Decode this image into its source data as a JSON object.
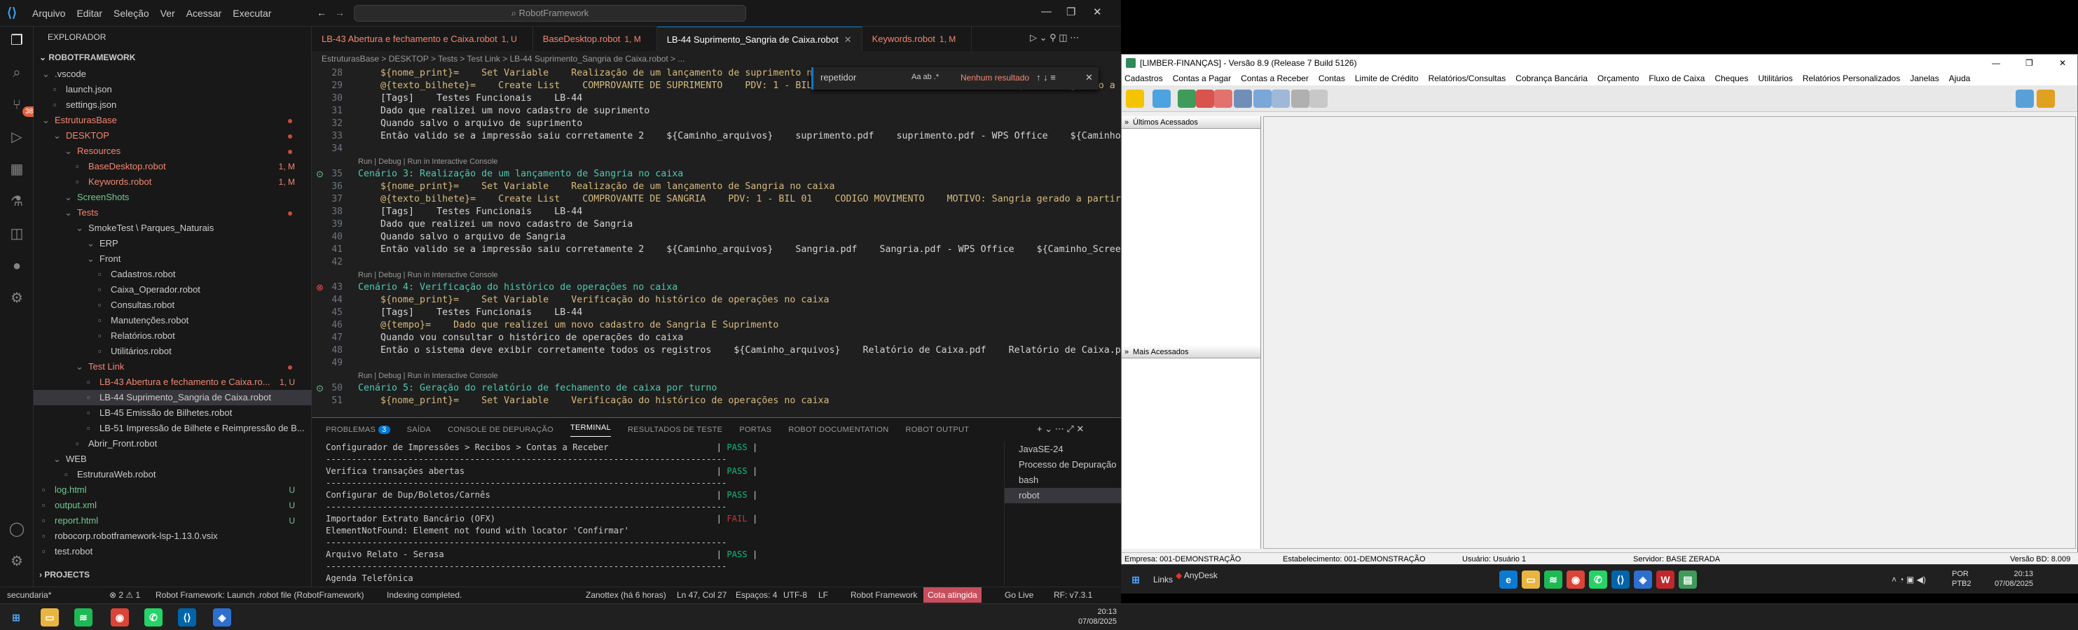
{
  "vscode": {
    "menu": [
      "Arquivo",
      "Editar",
      "Seleção",
      "Ver",
      "Acessar",
      "Executar"
    ],
    "command_center": "RobotFramework",
    "activity_badge": "385",
    "explorer_title": "EXPLORADOR",
    "workspace": "ROBOTFRAMEWORK",
    "tree": [
      {
        "label": ".vscode",
        "indent": 1,
        "kind": "folder"
      },
      {
        "label": "launch.json",
        "indent": 2,
        "kind": "file"
      },
      {
        "label": "settings.json",
        "indent": 2,
        "kind": "file"
      },
      {
        "label": "EstruturasBase",
        "indent": 1,
        "kind": "folder",
        "state": "err"
      },
      {
        "label": "DESKTOP",
        "indent": 2,
        "kind": "folder",
        "state": "err"
      },
      {
        "label": "Resources",
        "indent": 3,
        "kind": "folder",
        "state": "err"
      },
      {
        "label": "BaseDesktop.robot",
        "indent": 4,
        "kind": "file",
        "state": "err",
        "badge": "1, M"
      },
      {
        "label": "Keywords.robot",
        "indent": 4,
        "kind": "file",
        "state": "err",
        "badge": "1, M"
      },
      {
        "label": "ScreenShots",
        "indent": 3,
        "kind": "folder",
        "state": "new"
      },
      {
        "label": "Tests",
        "indent": 3,
        "kind": "folder",
        "state": "err"
      },
      {
        "label": "SmokeTest \\ Parques_Naturais",
        "indent": 4,
        "kind": "folder"
      },
      {
        "label": "ERP",
        "indent": 5,
        "kind": "folder"
      },
      {
        "label": "Front",
        "indent": 5,
        "kind": "folder"
      },
      {
        "label": "Cadastros.robot",
        "indent": 6,
        "kind": "file"
      },
      {
        "label": "Caixa_Operador.robot",
        "indent": 6,
        "kind": "file"
      },
      {
        "label": "Consultas.robot",
        "indent": 6,
        "kind": "file"
      },
      {
        "label": "Manutenções.robot",
        "indent": 6,
        "kind": "file"
      },
      {
        "label": "Relatórios.robot",
        "indent": 6,
        "kind": "file"
      },
      {
        "label": "Utilitários.robot",
        "indent": 6,
        "kind": "file"
      },
      {
        "label": "Test Link",
        "indent": 4,
        "kind": "folder",
        "state": "err"
      },
      {
        "label": "LB-43 Abertura e fechamento e Caixa.ro...",
        "indent": 5,
        "kind": "file",
        "state": "err",
        "badge": "1, U"
      },
      {
        "label": "LB-44 Suprimento_Sangria de Caixa.robot",
        "indent": 5,
        "kind": "file",
        "state": "sel"
      },
      {
        "label": "LB-45 Emissão de Bilhetes.robot",
        "indent": 5,
        "kind": "file"
      },
      {
        "label": "LB-51 Impressão de Bilhete e Reimpressão de B...",
        "indent": 5,
        "kind": "file"
      },
      {
        "label": "Abrir_Front.robot",
        "indent": 4,
        "kind": "file"
      },
      {
        "label": "WEB",
        "indent": 2,
        "kind": "folder"
      },
      {
        "label": "EstruturaWeb.robot",
        "indent": 3,
        "kind": "file"
      },
      {
        "label": "log.html",
        "indent": 1,
        "kind": "file",
        "state": "new",
        "badge": "U"
      },
      {
        "label": "output.xml",
        "indent": 1,
        "kind": "file",
        "state": "new",
        "badge": "U"
      },
      {
        "label": "report.html",
        "indent": 1,
        "kind": "file",
        "state": "new",
        "badge": "U"
      },
      {
        "label": "robocorp.robotframework-lsp-1.13.0.vsix",
        "indent": 1,
        "kind": "file"
      },
      {
        "label": "test.robot",
        "indent": 1,
        "kind": "file"
      }
    ],
    "projects_label": "PROJECTS",
    "tabs": [
      {
        "label": "LB-43 Abertura e fechamento e Caixa.robot",
        "badge": "1, U",
        "state": "err"
      },
      {
        "label": "BaseDesktop.robot",
        "badge": "1, M",
        "state": "err"
      },
      {
        "label": "LB-44 Suprimento_Sangria de Caixa.robot",
        "badge": "",
        "state": "act"
      },
      {
        "label": "Keywords.robot",
        "badge": "1, M",
        "state": "err"
      }
    ],
    "breadcrumb": "EstruturasBase > DESKTOP > Tests > Test Link > LB-44 Suprimento_Sangria de Caixa.robot > ...",
    "find": {
      "value": "repetidor",
      "result": "Nenhum resultado"
    },
    "code_lines": [
      {
        "n": "28",
        "t": "    ${nome_print}=    Set Variable    Realização de um lançamento de suprimento no caixa"
      },
      {
        "n": "29",
        "t": "    @{texto_bilhete}=    Create List    COMPROVANTE DE SUPRIMENTO    PDV: 1 - BIL 01    CODIGO MOVIMENTO    MOTIVO: Suprimento gerado a partir"
      },
      {
        "n": "30",
        "t": "    [Tags]    Testes Funcionais    LB-44"
      },
      {
        "n": "31",
        "t": "    Dado que realizei um novo cadastro de suprimento"
      },
      {
        "n": "32",
        "t": "    Quando salvo o arquivo de suprimento"
      },
      {
        "n": "33",
        "t": "    Então valido se a impressão saiu corretamente 2    ${Caminho_arquivos}    suprimento.pdf    suprimento.pdf - WPS Office    ${Caminho_Screen"
      },
      {
        "n": "34",
        "t": ""
      },
      {
        "n": "",
        "t": "Run | Debug | Run in Interactive Console",
        "lens": true
      },
      {
        "n": "35",
        "t": "Cenário 3: Realização de um lançamento de Sangria no caixa",
        "hdr": true
      },
      {
        "n": "36",
        "t": "    ${nome_print}=    Set Variable    Realização de um lançamento de Sangria no caixa"
      },
      {
        "n": "37",
        "t": "    @{texto_bilhete}=    Create List    COMPROVANTE DE SANGRIA    PDV: 1 - BIL 01    CODIGO MOVIMENTO    MOTIVO: Sangria gerado a partir de t"
      },
      {
        "n": "38",
        "t": "    [Tags]    Testes Funcionais    LB-44"
      },
      {
        "n": "39",
        "t": "    Dado que realizei um novo cadastro de Sangria"
      },
      {
        "n": "40",
        "t": "    Quando salvo o arquivo de Sangria"
      },
      {
        "n": "41",
        "t": "    Então valido se a impressão saiu corretamente 2    ${Caminho_arquivos}    Sangria.pdf    Sangria.pdf - WPS Office    ${Caminho_Screenshots}"
      },
      {
        "n": "42",
        "t": ""
      },
      {
        "n": "",
        "t": "Run | Debug | Run in Interactive Console",
        "lens": true
      },
      {
        "n": "43",
        "t": "Cenário 4: Verificação do histórico de operações no caixa",
        "hdr": true
      },
      {
        "n": "44",
        "t": "    ${nome_print}=    Set Variable    Verificação do histórico de operações no caixa"
      },
      {
        "n": "45",
        "t": "    [Tags]    Testes Funcionais    LB-44"
      },
      {
        "n": "46",
        "t": "    @{tempo}=    Dado que realizei um novo cadastro de Sangria E Suprimento"
      },
      {
        "n": "47",
        "t": "    Quando vou consultar o histórico de operações do caixa"
      },
      {
        "n": "48",
        "t": "    Então o sistema deve exibir corretamente todos os registros    ${Caminho_arquivos}    Relatório de Caixa.pdf    Relatório de Caixa.pdf - W"
      },
      {
        "n": "49",
        "t": ""
      },
      {
        "n": "",
        "t": "Run | Debug | Run in Interactive Console",
        "lens": true
      },
      {
        "n": "50",
        "t": "Cenário 5: Geração do relatório de fechamento de caixa por turno",
        "hdr": true
      },
      {
        "n": "51",
        "t": "    ${nome_print}=    Set Variable    Verificação do histórico de operações no caixa"
      }
    ],
    "panel_tabs": [
      "PROBLEMAS",
      "SAÍDA",
      "CONSOLE DE DEPURAÇÃO",
      "TERMINAL",
      "RESULTADOS DE TESTE",
      "PORTAS",
      "ROBOT DOCUMENTATION",
      "ROBOT OUTPUT"
    ],
    "problems_count": "3",
    "terminal_lines": [
      {
        "t": "Configurador de Impressões > Recibos > Contas a Receber                     | ",
        "r": "PASS"
      },
      {
        "t": "------------------------------------------------------------------------------"
      },
      {
        "t": "Verifica transações abertas                                                 | ",
        "r": "PASS"
      },
      {
        "t": "------------------------------------------------------------------------------"
      },
      {
        "t": "Configurar de Dup/Boletos/Carnês                                            | ",
        "r": "PASS"
      },
      {
        "t": "------------------------------------------------------------------------------"
      },
      {
        "t": "Importador Extrato Bancário (OFX)                                           | ",
        "r": "FAIL"
      },
      {
        "t": "ElementNotFound: Element not found with locator 'Confirmar'"
      },
      {
        "t": "------------------------------------------------------------------------------"
      },
      {
        "t": "Arquivo Relato - Serasa                                                     | ",
        "r": "PASS"
      },
      {
        "t": "------------------------------------------------------------------------------"
      },
      {
        "t": "Agenda Telefônica"
      }
    ],
    "terminal_list": [
      "JavaSE-24",
      "Processo de Depuração",
      "bash",
      "robot"
    ],
    "status": {
      "branch": "secundaria*",
      "problems": "⊗ 2 ⚠ 1",
      "launch": "Robot Framework: Launch .robot file (RobotFramework)",
      "indexing": "Indexing completed.",
      "blame": "Zanottex (há 6 horas)",
      "position": "Ln 47, Col 27",
      "spaces": "Espaços: 4",
      "encoding": "UTF-8",
      "eol": "LF",
      "language": "Robot Framework",
      "quota": "Cota atingida",
      "golive": "Go Live",
      "rf": "RF: v7.3.1"
    }
  },
  "limber": {
    "title": "[LIMBER-FINANÇAS] - Versão 8.9 (Release 7 Build 5126)",
    "menu": [
      "Cadastros",
      "Contas a Pagar",
      "Contas a Receber",
      "Contas",
      "Limite de Crédito",
      "Relatórios/Consultas",
      "Cobrança Bancária",
      "Orçamento",
      "Fluxo de Caixa",
      "Cheques",
      "Utilitários",
      "Relatórios Personalizados",
      "Janelas",
      "Ajuda"
    ],
    "pane_recent": "Últimos Acessados",
    "pane_most": "Mais Acessados",
    "status": {
      "empresa": "Empresa: 001-DEMONSTRAÇÃO",
      "estab": "Estabelecimento: 001-DEMONSTRAÇÃO",
      "usuario": "Usuário: Usuário 1",
      "servidor": "Servidor: BASE ZERADA",
      "versao": "Versão BD: 8.009"
    }
  },
  "taskbar_right": {
    "links": "Links",
    "anydesk": "AnyDesk",
    "lang": "POR",
    "layout": "PTB2",
    "time": "20:13",
    "date": "07/08/2025"
  },
  "taskbar_left": {
    "time": "20:13",
    "date": "07/08/2025"
  },
  "colors": {
    "accent": "#0078d4",
    "pass": "#0dbc79",
    "fail": "#cd3131",
    "quota": "#c74e5c"
  }
}
